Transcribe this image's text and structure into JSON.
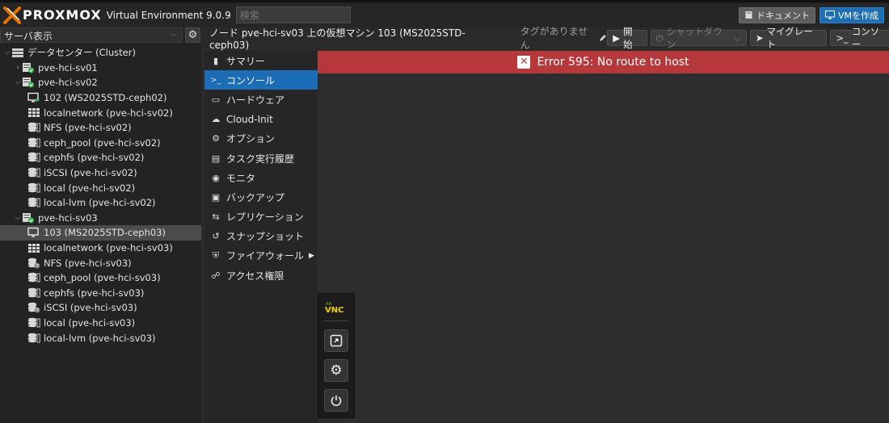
{
  "app": {
    "brand": "PROXMOX",
    "product": "Virtual Environment 9.0.9",
    "search_placeholder": "検索",
    "doc_label": "ドキュメント",
    "create_vm_label": "VMを作成"
  },
  "left": {
    "view_select": "サーバ表示",
    "tree": [
      {
        "label": "データセンター (Cluster)",
        "icon": "datacenter-icon",
        "level": 0,
        "expander": "open"
      },
      {
        "label": "pve-hci-sv01",
        "icon": "node-online-icon",
        "level": 1,
        "expander": "closed"
      },
      {
        "label": "pve-hci-sv02",
        "icon": "node-online-icon",
        "level": 1,
        "expander": "open"
      },
      {
        "label": "102 (WS2025STD-ceph02)",
        "icon": "vm-running-icon",
        "level": 2
      },
      {
        "label": "localnetwork (pve-hci-sv02)",
        "icon": "network-grid-icon",
        "level": 2
      },
      {
        "label": "NFS (pve-hci-sv02)",
        "icon": "storage-icon",
        "level": 2
      },
      {
        "label": "ceph_pool (pve-hci-sv02)",
        "icon": "storage-icon",
        "level": 2
      },
      {
        "label": "cephfs (pve-hci-sv02)",
        "icon": "storage-icon",
        "level": 2
      },
      {
        "label": "iSCSI (pve-hci-sv02)",
        "icon": "storage-icon",
        "level": 2
      },
      {
        "label": "local (pve-hci-sv02)",
        "icon": "storage-icon",
        "level": 2
      },
      {
        "label": "local-lvm (pve-hci-sv02)",
        "icon": "storage-icon",
        "level": 2
      },
      {
        "label": "pve-hci-sv03",
        "icon": "node-online-icon",
        "level": 1,
        "expander": "open"
      },
      {
        "label": "103 (MS2025STD-ceph03)",
        "icon": "vm-stopped-icon",
        "level": 2,
        "selected": true
      },
      {
        "label": "localnetwork (pve-hci-sv03)",
        "icon": "network-grid-icon",
        "level": 2
      },
      {
        "label": "NFS (pve-hci-sv03)",
        "icon": "storage-unknown-icon",
        "level": 2
      },
      {
        "label": "ceph_pool (pve-hci-sv03)",
        "icon": "storage-icon",
        "level": 2
      },
      {
        "label": "cephfs (pve-hci-sv03)",
        "icon": "storage-icon",
        "level": 2
      },
      {
        "label": "iSCSI (pve-hci-sv03)",
        "icon": "storage-unknown-icon",
        "level": 2
      },
      {
        "label": "local (pve-hci-sv03)",
        "icon": "storage-icon",
        "level": 2
      },
      {
        "label": "local-lvm (pve-hci-sv03)",
        "icon": "storage-icon",
        "level": 2
      }
    ]
  },
  "header": {
    "title": "ノード pve-hci-sv03 上の仮想マシン 103 (MS2025STD-ceph03)",
    "tags": "タグがありません",
    "start_label": "開始",
    "shutdown_label": "シャットダウン",
    "migrate_label": "マイグレート",
    "console_label": "コンソー"
  },
  "nav": [
    {
      "label": "サマリー",
      "icon": "book-icon"
    },
    {
      "label": "コンソール",
      "icon": "terminal-icon",
      "selected": true
    },
    {
      "label": "ハードウェア",
      "icon": "monitor-icon"
    },
    {
      "label": "Cloud-Init",
      "icon": "cloud-icon"
    },
    {
      "label": "オプション",
      "icon": "gear-icon"
    },
    {
      "label": "タスク実行履歴",
      "icon": "list-icon"
    },
    {
      "label": "モニタ",
      "icon": "eye-icon"
    },
    {
      "label": "バックアップ",
      "icon": "save-icon"
    },
    {
      "label": "レプリケーション",
      "icon": "retweet-icon"
    },
    {
      "label": "スナップショット",
      "icon": "history-icon"
    },
    {
      "label": "ファイアウォール",
      "icon": "shield-icon",
      "submenu": true
    },
    {
      "label": "アクセス権限",
      "icon": "unlock-icon"
    }
  ],
  "console": {
    "error": "Error 595: No route to host",
    "vnc_logo": "VNC",
    "vnc_logo_small": "no"
  },
  "colors": {
    "accent": "#1c6cb6",
    "error": "#b7383a",
    "online": "#2db34a"
  }
}
